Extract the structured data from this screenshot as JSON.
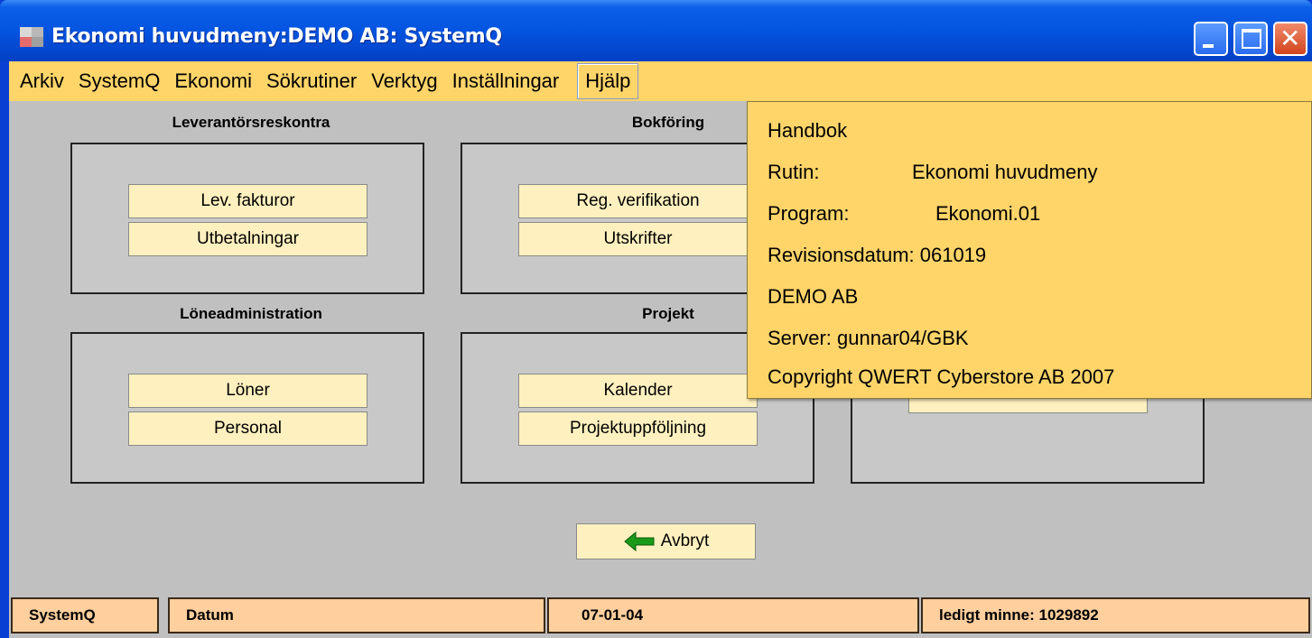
{
  "window": {
    "title": "Ekonomi huvudmeny:DEMO AB: SystemQ",
    "close_glyph": "✕"
  },
  "menu": {
    "items": [
      "Arkiv",
      "SystemQ",
      "Ekonomi",
      "Sökrutiner",
      "Verktyg",
      "Inställningar",
      "Hjälp"
    ]
  },
  "groups": [
    {
      "title": "Leverantörsreskontra",
      "buttons": [
        "Lev. fakturor",
        "Utbetalningar"
      ]
    },
    {
      "title": "Bokföring",
      "buttons": [
        "Reg. verifikation",
        "Utskrifter"
      ]
    },
    {
      "title": "Löneadministration",
      "buttons": [
        "Löner",
        "Personal"
      ]
    },
    {
      "title": "Projekt",
      "buttons": [
        "Kalender",
        "Projektuppföljning"
      ]
    }
  ],
  "cancel_button": {
    "label": "Avbryt"
  },
  "help_menu": {
    "handbook": "Handbok",
    "rutin_label": "Rutin:",
    "rutin_value": "Ekonomi huvudmeny",
    "program_label": "Program:",
    "program_value": "Ekonomi.01",
    "revision": "Revisionsdatum:  061019",
    "company": "DEMO AB",
    "server": "Server:  gunnar04/GBK",
    "copyright": "Copyright QWERT Cyberstore AB 2007"
  },
  "status": {
    "app": "SystemQ",
    "date_label": "Datum",
    "date_value": "07-01-04",
    "memory": "ledigt minne: 1029892"
  },
  "colors": {
    "menu_bg": "#ffd569",
    "button_bg": "#fff1bf",
    "status_bg": "#ffcf9d",
    "titlebar": "#0454e0",
    "client_bg": "#c0c0c0"
  }
}
